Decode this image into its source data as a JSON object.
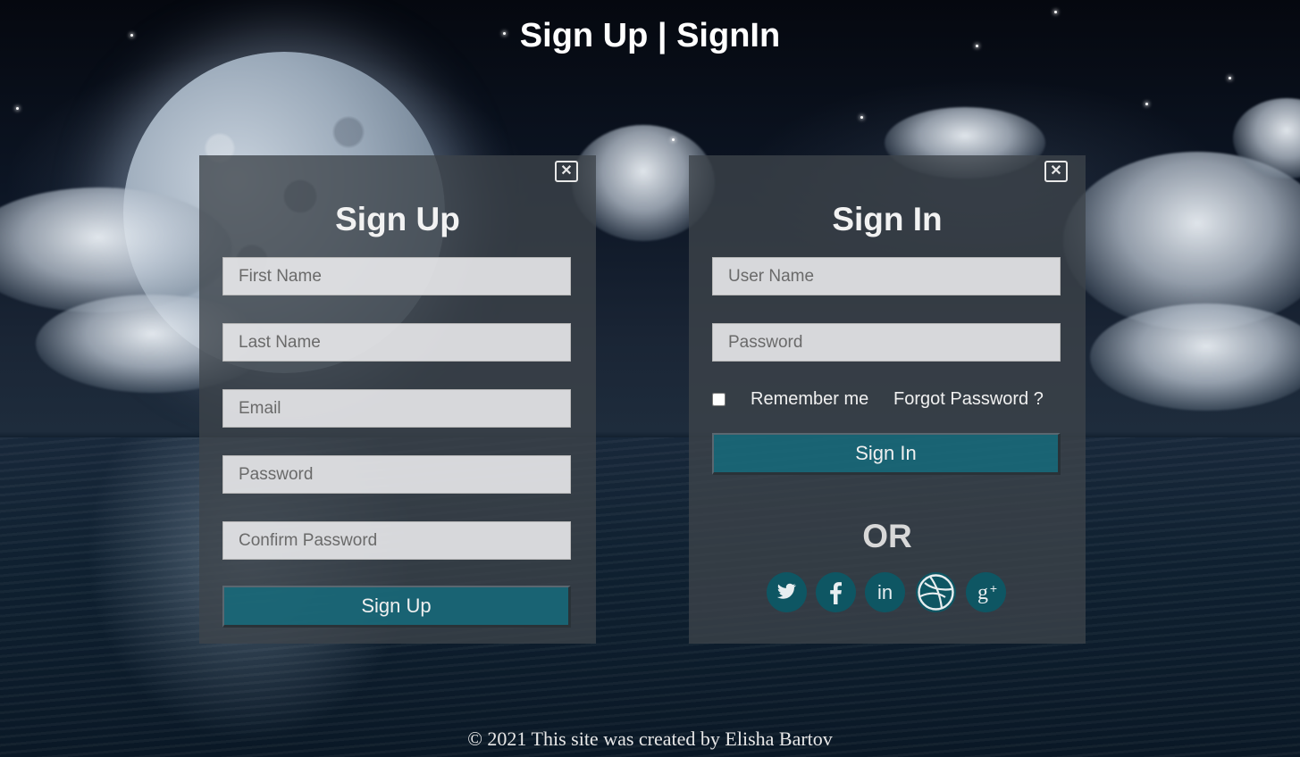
{
  "header": {
    "title": "Sign Up | SignIn"
  },
  "signup": {
    "heading": "Sign Up",
    "close_icon": "close-icon",
    "fields": {
      "first_name": {
        "placeholder": "First Name",
        "value": ""
      },
      "last_name": {
        "placeholder": "Last Name",
        "value": ""
      },
      "email": {
        "placeholder": "Email",
        "value": ""
      },
      "password": {
        "placeholder": "Password",
        "value": ""
      },
      "confirm_password": {
        "placeholder": "Confirm Password",
        "value": ""
      }
    },
    "submit_label": "Sign Up"
  },
  "signin": {
    "heading": "Sign In",
    "close_icon": "close-icon",
    "fields": {
      "username": {
        "placeholder": "User Name",
        "value": ""
      },
      "password": {
        "placeholder": "Password",
        "value": ""
      }
    },
    "remember_label": "Remember me",
    "remember_checked": false,
    "forgot_label": "Forgot Password ?",
    "submit_label": "Sign In",
    "or_label": "OR",
    "social": [
      {
        "name": "twitter-icon",
        "color": "#0e5663"
      },
      {
        "name": "facebook-icon",
        "color": "#0e5663"
      },
      {
        "name": "linkedin-icon",
        "color": "#0e5663"
      },
      {
        "name": "dribbble-icon",
        "color": "#0e5663"
      },
      {
        "name": "google-plus-icon",
        "color": "#0e5663"
      }
    ]
  },
  "footer": {
    "text": "© 2021 This site was created by Elisha Bartov"
  },
  "colors": {
    "accent": "#126e80",
    "panel_bg": "#3e444a",
    "text": "#ffffff"
  }
}
